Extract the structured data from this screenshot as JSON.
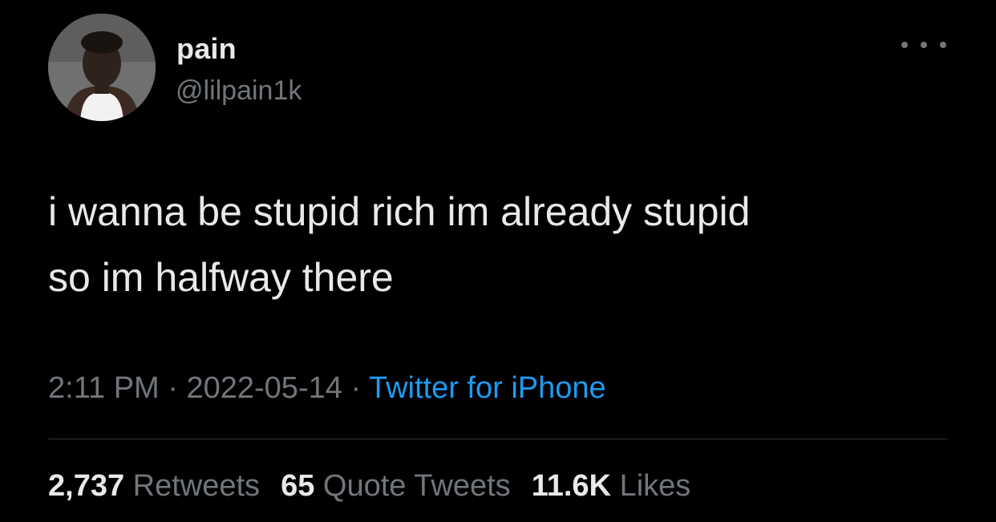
{
  "tweet": {
    "author": {
      "display_name": "pain",
      "handle": "@lilpain1k",
      "avatar_icon": "profile-photo"
    },
    "more_icon": "more-horizontal-icon",
    "text_lines": [
      "i wanna be stupid rich im already stupid",
      "so im halfway there"
    ],
    "meta": {
      "time": "2:11 PM",
      "separator": "·",
      "date": "2022-05-14",
      "source": "Twitter for iPhone"
    },
    "stats": {
      "retweets_count": "2,737",
      "retweets_label": "Retweets",
      "quotes_count": "65",
      "quotes_label": "Quote Tweets",
      "likes_count": "11.6K",
      "likes_label": "Likes"
    }
  },
  "colors": {
    "background": "#000000",
    "primary_text": "#e7e9ea",
    "secondary_text": "#71767b",
    "link": "#1d9bf0",
    "divider": "#2f3336"
  }
}
